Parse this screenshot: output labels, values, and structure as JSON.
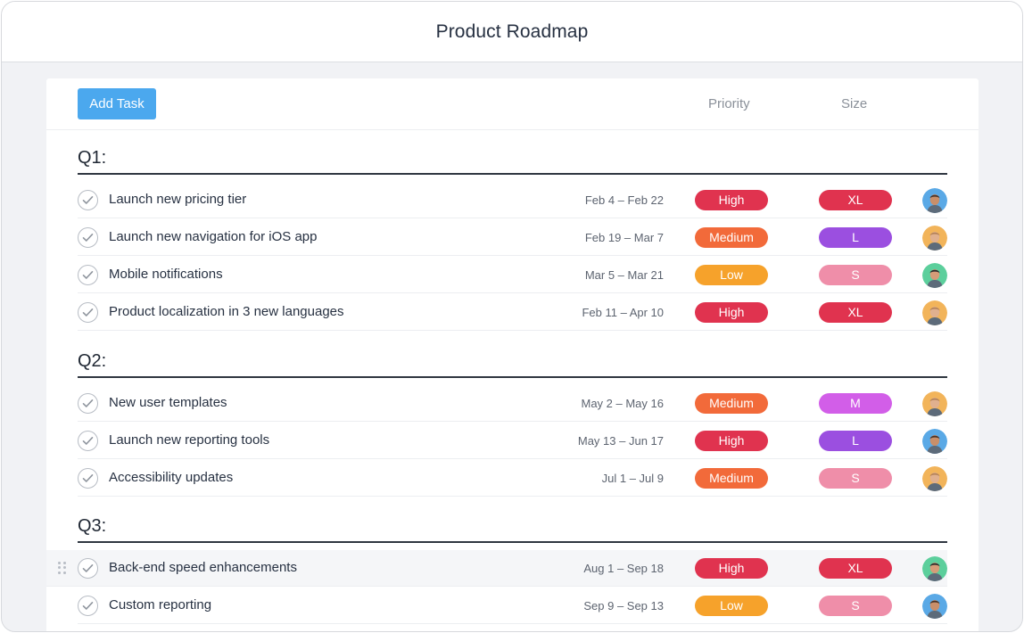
{
  "window": {
    "title": "Product Roadmap"
  },
  "toolbar": {
    "add_task_label": "Add Task",
    "columns": {
      "priority": "Priority",
      "size": "Size"
    }
  },
  "colors": {
    "accent": "#4ba8ee",
    "priority": {
      "High": "#e0334f",
      "Medium": "#f26a3a",
      "Low": "#f6a22b"
    },
    "size": {
      "XL": "#e0334f",
      "L": "#9b4fe0",
      "M": "#d25ee8",
      "S": "#ef8ea9"
    }
  },
  "sections": [
    {
      "title": "Q1:",
      "tasks": [
        {
          "name": "Launch new pricing tier",
          "dates": "Feb 4 – Feb 22",
          "priority": "High",
          "size": "XL",
          "assignee": "avatar-blue"
        },
        {
          "name": "Launch new navigation for iOS app",
          "dates": "Feb 19 – Mar 7",
          "priority": "Medium",
          "size": "L",
          "assignee": "avatar-orange"
        },
        {
          "name": "Mobile notifications",
          "dates": "Mar 5 – Mar 21",
          "priority": "Low",
          "size": "S",
          "assignee": "avatar-green"
        },
        {
          "name": "Product localization in 3 new languages",
          "dates": "Feb 11 – Apr 10",
          "priority": "High",
          "size": "XL",
          "assignee": "avatar-orange"
        }
      ]
    },
    {
      "title": "Q2:",
      "tasks": [
        {
          "name": "New user templates",
          "dates": "May 2 – May 16",
          "priority": "Medium",
          "size": "M",
          "assignee": "avatar-orange"
        },
        {
          "name": "Launch new reporting tools",
          "dates": "May 13 – Jun 17",
          "priority": "High",
          "size": "L",
          "assignee": "avatar-blue"
        },
        {
          "name": "Accessibility updates",
          "dates": "Jul 1 – Jul 9",
          "priority": "Medium",
          "size": "S",
          "assignee": "avatar-orange"
        }
      ]
    },
    {
      "title": "Q3:",
      "tasks": [
        {
          "name": "Back-end speed enhancements",
          "dates": "Aug 1 – Sep 18",
          "priority": "High",
          "size": "XL",
          "assignee": "avatar-green",
          "hovered": true
        },
        {
          "name": "Custom reporting",
          "dates": "Sep 9 – Sep 13",
          "priority": "Low",
          "size": "S",
          "assignee": "avatar-blue"
        }
      ]
    }
  ],
  "icons": {
    "checkmark": "check-icon",
    "drag": "drag-handle-icon",
    "avatars": {
      "avatar-blue": {
        "bg": "#5aa9e6",
        "skin": "#c98f6a",
        "hair": "#4a3428"
      },
      "avatar-orange": {
        "bg": "#f2b45a",
        "skin": "#e0b08f",
        "hair": "#b5835a"
      },
      "avatar-green": {
        "bg": "#5ccf9c",
        "skin": "#d69c78",
        "hair": "#2b2b2b"
      }
    }
  }
}
